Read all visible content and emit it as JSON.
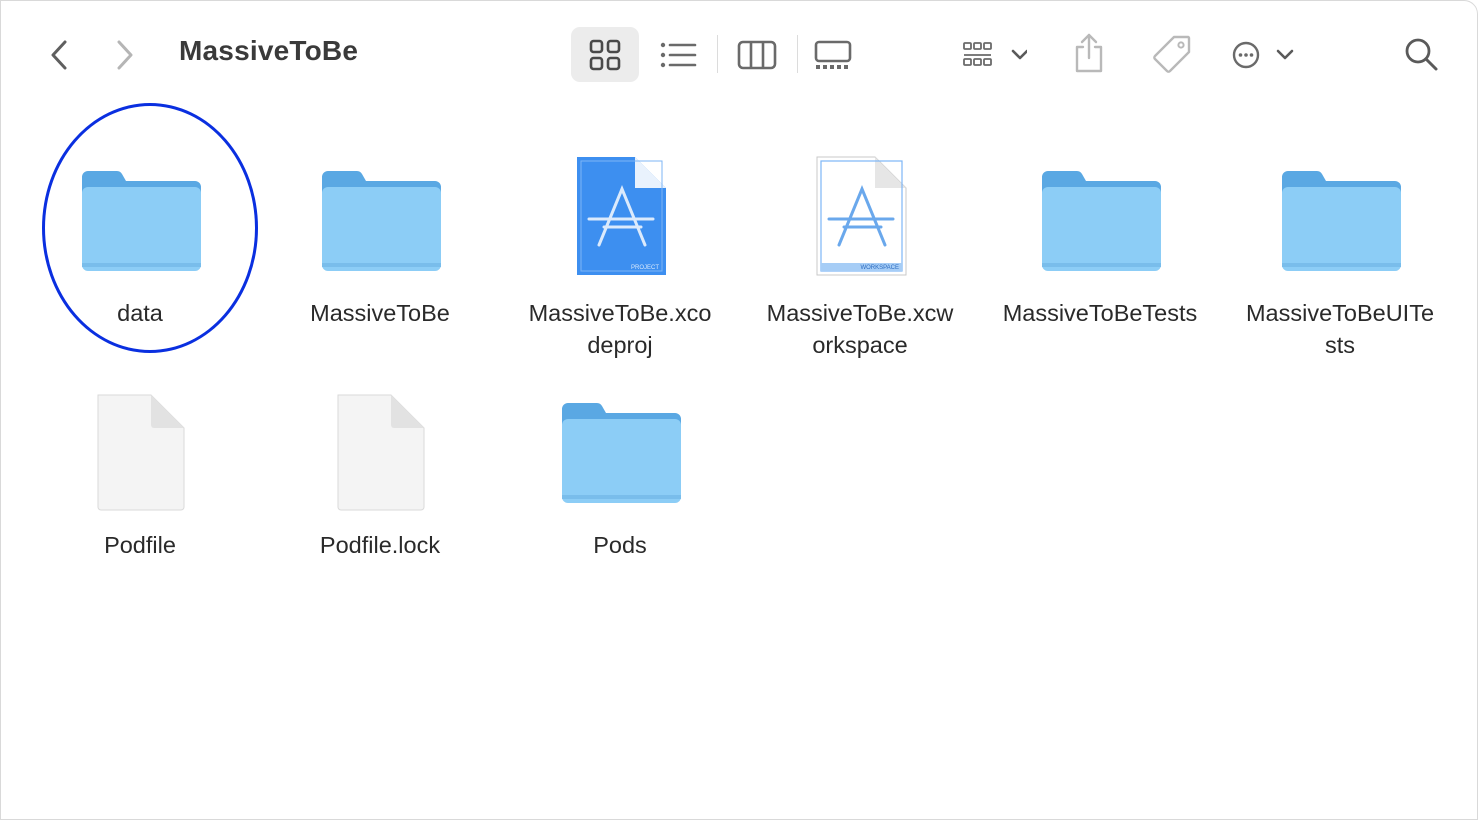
{
  "window": {
    "title": "MassiveToBe"
  },
  "toolbar": {
    "back_icon": "chevron-left-icon",
    "forward_icon": "chevron-right-icon",
    "view_icons": [
      "icon-view-icon",
      "list-view-icon",
      "column-view-icon",
      "gallery-view-icon"
    ],
    "active_view": "icon-view",
    "group_icon": "group-by-icon",
    "share_icon": "share-icon",
    "tag_icon": "tag-icon",
    "more_icon": "more-actions-icon",
    "search_icon": "search-icon"
  },
  "files": [
    {
      "label": "data",
      "kind": "folder"
    },
    {
      "label": "MassiveToBe",
      "kind": "folder"
    },
    {
      "label": "MassiveToBe.xco\ndeproj",
      "kind": "xcodeproj",
      "badge": "PROJECT"
    },
    {
      "label": "MassiveToBe.xcw\norkspace",
      "kind": "xcworkspace",
      "badge": "WORKSPACE"
    },
    {
      "label": "MassiveToBeTests",
      "kind": "folder"
    },
    {
      "label": "MassiveToBeUITe\nsts",
      "kind": "folder"
    },
    {
      "label": "Podfile",
      "kind": "document"
    },
    {
      "label": "Podfile.lock",
      "kind": "document"
    },
    {
      "label": "Pods",
      "kind": "folder"
    }
  ],
  "colors": {
    "folder_body": "#8ccdf6",
    "folder_tab": "#5aa8e3",
    "annotation": "#0a2fe0",
    "project_blue": "#3d8ff0"
  },
  "annotation": {
    "target": "data"
  }
}
